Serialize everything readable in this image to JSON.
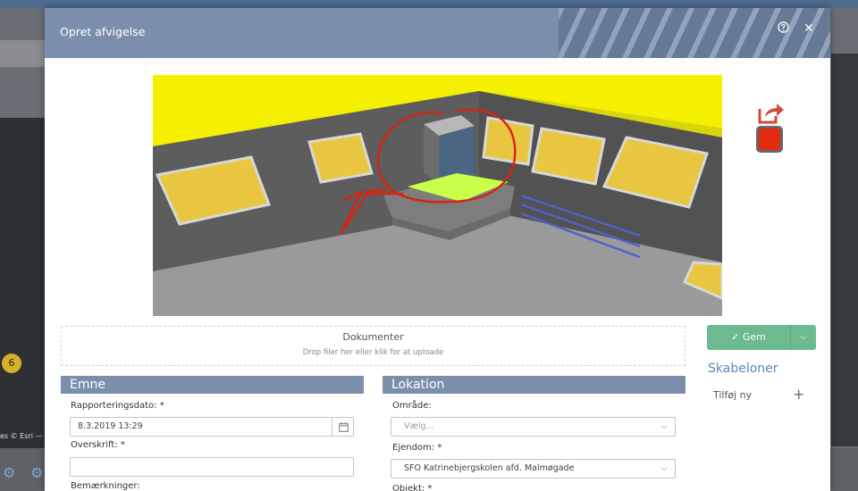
{
  "modal": {
    "title": "Opret afvigelse",
    "help_icon": "help-circle-icon",
    "close_label": "✕"
  },
  "dropzone": {
    "title": "Dokumenter",
    "subtitle": "Drop filer her eller klik for at uploade"
  },
  "actions": {
    "save_label": "Gem"
  },
  "templates": {
    "title": "Skabeloner",
    "add_label": "Tilføj ny"
  },
  "emne": {
    "title": "Emne",
    "date_label": "Rapporteringsdato: *",
    "date_value": "8.3.2019 13:29",
    "headline_label": "Overskrift: *",
    "headline_value": "",
    "notes_label": "Bemærkninger:"
  },
  "lokation": {
    "title": "Lokation",
    "area_label": "Område:",
    "area_placeholder": "Vælg...",
    "property_label": "Ejendom: *",
    "property_value": "SFO Katrinebjergskolen afd. Malmøgade",
    "object_label": "Objekt: *"
  },
  "background": {
    "map_badge": "6",
    "map_credit": "es © Esri —"
  },
  "colors": {
    "header": "#7b8fad",
    "save": "#6cba8f",
    "markup": "#e32b14",
    "highlight": "#c7ff4a"
  }
}
